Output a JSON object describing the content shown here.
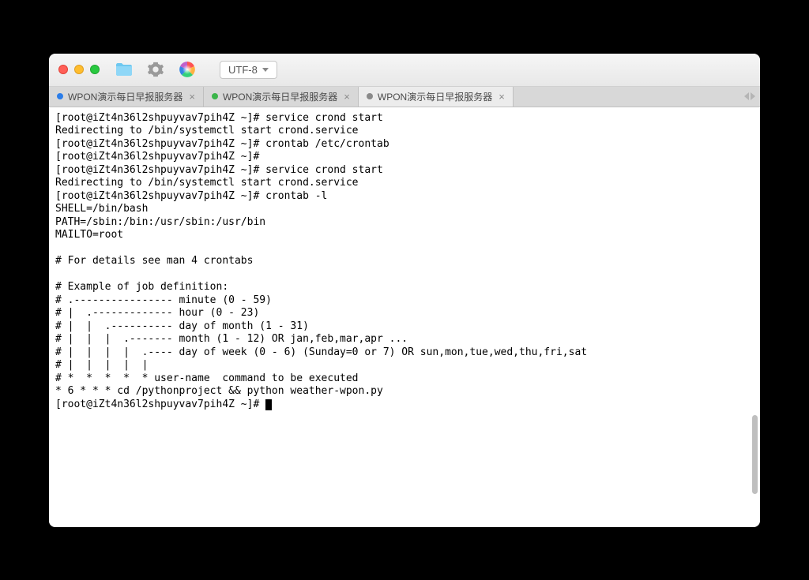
{
  "toolbar": {
    "encoding_label": "UTF-8"
  },
  "tabs": [
    {
      "label": "WPON演示每日早报服务器",
      "dot": "blue",
      "active": false
    },
    {
      "label": "WPON演示每日早报服务器",
      "dot": "green",
      "active": false
    },
    {
      "label": "WPON演示每日早报服务器",
      "dot": "gray",
      "active": true
    }
  ],
  "terminal_lines": [
    "[root@iZt4n36l2shpuyvav7pih4Z ~]# service crond start",
    "Redirecting to /bin/systemctl start crond.service",
    "[root@iZt4n36l2shpuyvav7pih4Z ~]# crontab /etc/crontab",
    "[root@iZt4n36l2shpuyvav7pih4Z ~]#",
    "[root@iZt4n36l2shpuyvav7pih4Z ~]# service crond start",
    "Redirecting to /bin/systemctl start crond.service",
    "[root@iZt4n36l2shpuyvav7pih4Z ~]# crontab -l",
    "SHELL=/bin/bash",
    "PATH=/sbin:/bin:/usr/sbin:/usr/bin",
    "MAILTO=root",
    "",
    "# For details see man 4 crontabs",
    "",
    "# Example of job definition:",
    "# .---------------- minute (0 - 59)",
    "# |  .------------- hour (0 - 23)",
    "# |  |  .---------- day of month (1 - 31)",
    "# |  |  |  .------- month (1 - 12) OR jan,feb,mar,apr ...",
    "# |  |  |  |  .---- day of week (0 - 6) (Sunday=0 or 7) OR sun,mon,tue,wed,thu,fri,sat",
    "# |  |  |  |  |",
    "# *  *  *  *  * user-name  command to be executed",
    "* 6 * * * cd /pythonproject && python weather-wpon.py"
  ],
  "terminal_prompt": "[root@iZt4n36l2shpuyvav7pih4Z ~]# "
}
